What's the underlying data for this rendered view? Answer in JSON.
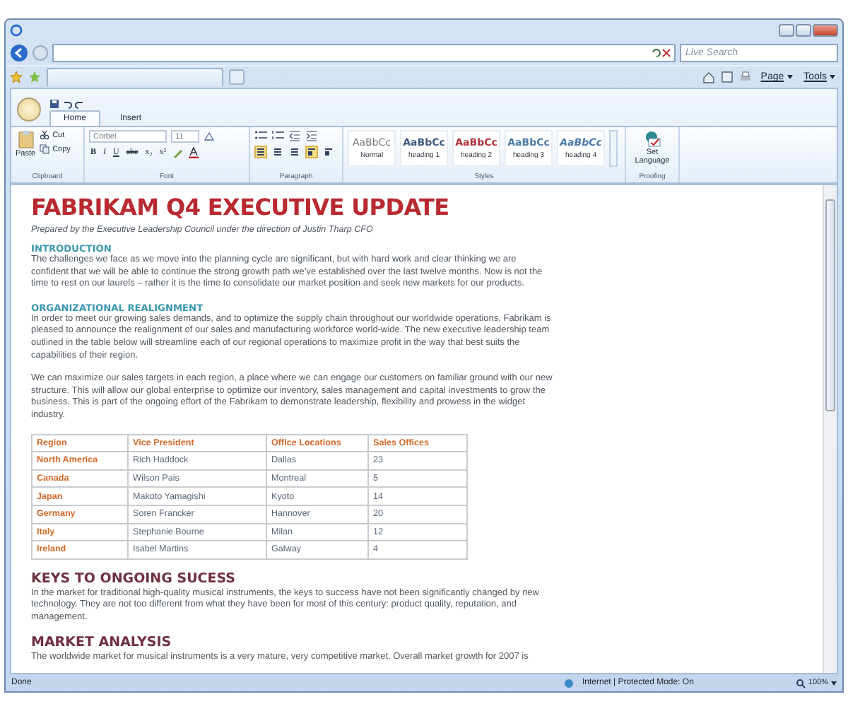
{
  "browser": {
    "search": {
      "placeholder": "Live Search"
    },
    "toolbar": [
      {
        "label": "Page"
      },
      {
        "label": "Tools"
      }
    ]
  },
  "ribbon": {
    "tabs": [
      {
        "label": "Home",
        "selected": true
      },
      {
        "label": "Insert",
        "selected": false
      }
    ],
    "clipboard": {
      "paste": "Paste",
      "cut": "Cut",
      "copy": "Copy",
      "label": "Clipboard"
    },
    "font": {
      "name": "Corbel",
      "size": "11",
      "buttons": [
        {
          "label": "B",
          "kind": "bold"
        },
        {
          "label": "I",
          "kind": "italic"
        },
        {
          "label": "U",
          "kind": "underline"
        },
        {
          "label": "abc",
          "kind": "strike"
        },
        {
          "label": "x₂",
          "kind": "plain"
        },
        {
          "label": "x²",
          "kind": "plain"
        }
      ],
      "label": "Font"
    },
    "paragraph": {
      "align": [
        {
          "selected": true
        },
        {
          "selected": false
        },
        {
          "selected": false
        }
      ],
      "direction": [
        {
          "selected": true
        },
        {
          "selected": false
        }
      ],
      "label": "Paragraph"
    },
    "styles": {
      "items": [
        {
          "sample": "AaBbCc",
          "name": "Normal",
          "color": "#7a7a7a",
          "italic": false
        },
        {
          "sample": "AaBbCc",
          "name": "heading 1",
          "color": "#3c5a80",
          "italic": false
        },
        {
          "sample": "AaBbCc",
          "name": "heading 2",
          "color": "#b0363a",
          "italic": false
        },
        {
          "sample": "AaBbCc",
          "name": "heading 3",
          "color": "#4a7aa8",
          "italic": false
        },
        {
          "sample": "AaBbCc",
          "name": "heading 4",
          "color": "#4a7aa8",
          "italic": true
        }
      ],
      "label": "Styles"
    },
    "proofing": {
      "button": "Set Language",
      "label": "Proofing"
    }
  },
  "document": {
    "blocks": [
      {
        "kind": "title",
        "text": "FABRIKAM Q4 EXECUTIVE UPDATE"
      },
      {
        "kind": "subtitle",
        "text": "Prepared by the Executive Leadership Council under the direction of Justin Tharp CFO"
      },
      {
        "kind": "section",
        "text": "INTRODUCTION"
      },
      {
        "kind": "paragraph",
        "text": "The challenges we face as we move into the planning cycle are significant, but with hard work and clear thinking we are confident that we will be able to continue the strong growth path we’ve established over the last twelve months.  Now is not the time to rest on our laurels – rather it is the time to consolidate our market position and seek new markets for our products."
      },
      {
        "kind": "section",
        "text": "ORGANIZATIONAL REALIGNMENT"
      },
      {
        "kind": "paragraph",
        "text": "In order to meet our growing sales demands, and to optimize the supply chain throughout our worldwide operations, Fabrikam is pleased to announce the realignment of our sales and manufacturing workforce world-wide. The new executive leadership team outlined in the table below will streamline each of our regional operations to maximize profit in the way that best suits the capabilities of their region."
      },
      {
        "kind": "paragraph",
        "text": "We can maximize our sales targets in each region, a place where we can engage our customers on familiar ground with our new structure. This will allow our global enterprise to optimize our inventory, sales management and capital investments to grow the business. This is part of the ongoing effort of the Fabrikam to demonstrate leadership, flexibility and prowess in the widget industry."
      },
      {
        "kind": "table",
        "columns": [
          "Region",
          "Vice President",
          "Office Locations",
          "Sales Offices"
        ],
        "rows": [
          [
            "North America",
            "Rich Haddock",
            "Dallas",
            "23"
          ],
          [
            "Canada",
            "Wilson Pais",
            "Montreal",
            "5"
          ],
          [
            "Japan",
            "Makoto Yamagishi",
            "Kyoto",
            "14"
          ],
          [
            "Germany",
            "Soren Francker",
            "Hannover",
            "20"
          ],
          [
            "Italy",
            "Stephanie Bourne",
            "Milan",
            "12"
          ],
          [
            "Ireland",
            "Isabel Martins",
            "Galway",
            "4"
          ]
        ]
      },
      {
        "kind": "heading",
        "text": "KEYS TO ONGOING SUCESS"
      },
      {
        "kind": "paragraph",
        "text": "In the market for traditional high-quality musical instruments, the keys to success have not been significantly changed by new technology. They are not too different from what they have been for most of this century: product quality, reputation, and management."
      },
      {
        "kind": "heading",
        "text": "MARKET ANALYSIS"
      },
      {
        "kind": "paragraph",
        "text": "The worldwide market for musical instruments is a very mature, very competitive market. Overall market growth for 2007 is"
      }
    ]
  },
  "status_bar": {
    "text": "Done",
    "zone": "Internet | Protected Mode: On",
    "zoom": "100%"
  }
}
